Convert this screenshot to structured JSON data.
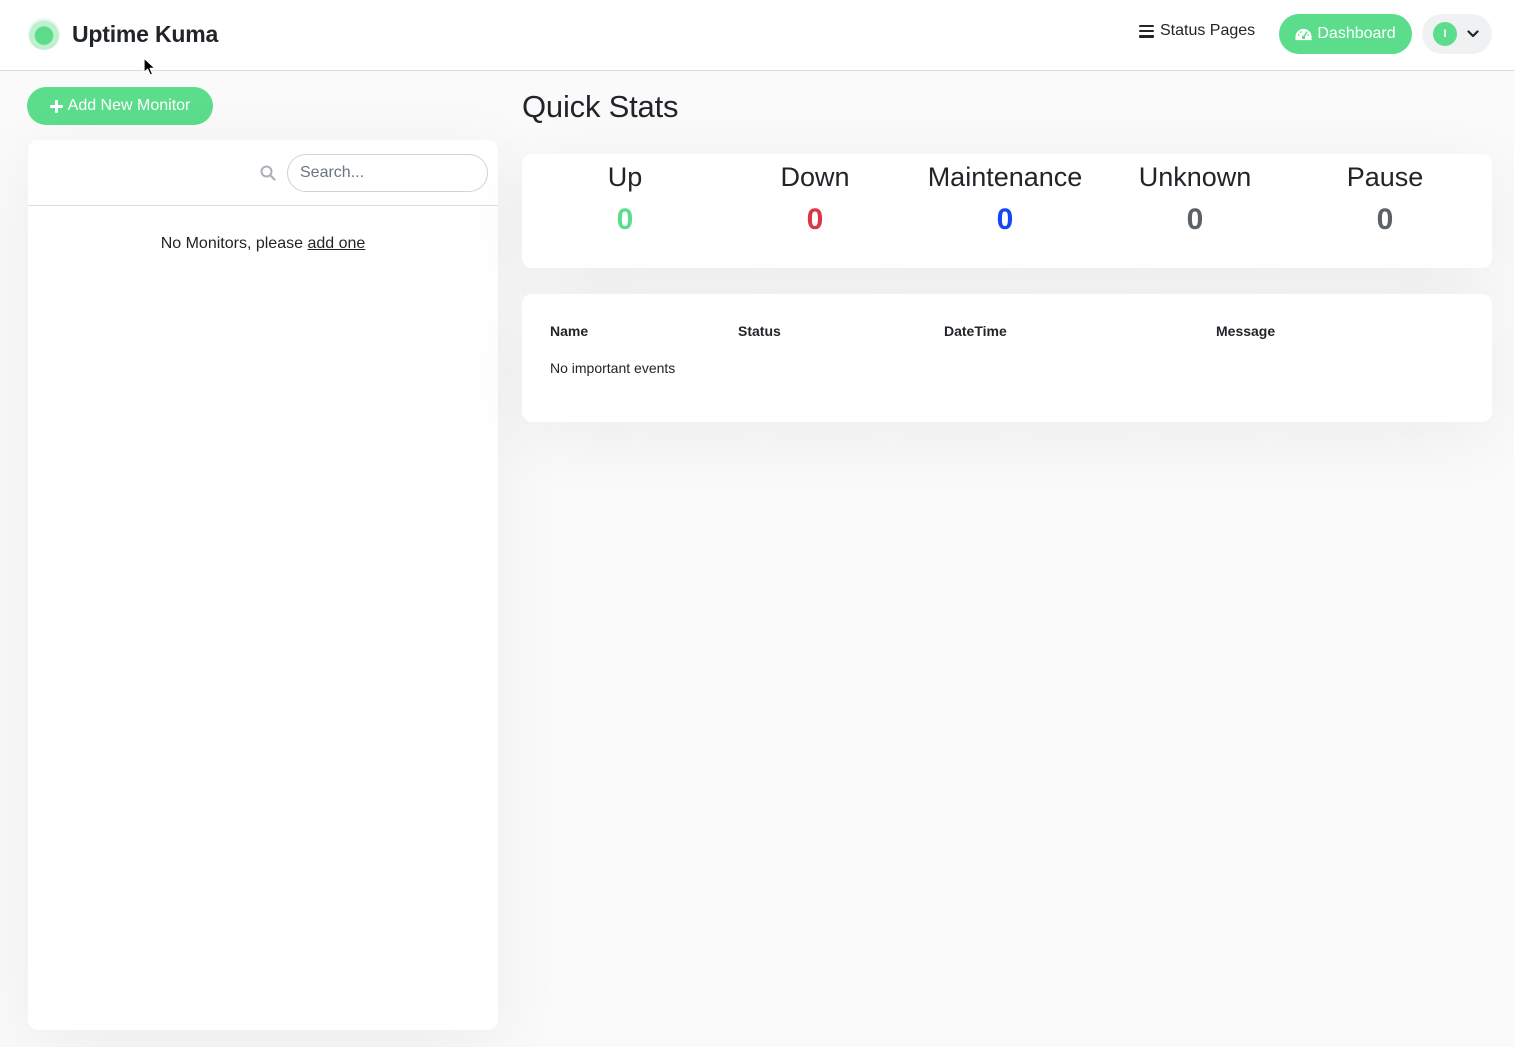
{
  "header": {
    "brand": "Uptime Kuma",
    "nav_status_pages": "Status Pages",
    "dashboard_label": "Dashboard",
    "avatar_initial": "I",
    "accent_color": "#5cdd8b"
  },
  "sidebar": {
    "add_button_label": "Add New Monitor",
    "search_placeholder": "Search...",
    "search_value": "",
    "empty_prefix": "No Monitors, please",
    "empty_link": "add one"
  },
  "main": {
    "title": "Quick Stats",
    "stats": [
      {
        "label": "Up",
        "value": "0",
        "color": "#5cdd8b"
      },
      {
        "label": "Down",
        "value": "0",
        "color": "#dc3545"
      },
      {
        "label": "Maintenance",
        "value": "0",
        "color": "#1747f5"
      },
      {
        "label": "Unknown",
        "value": "0",
        "color": "#5a6268"
      },
      {
        "label": "Pause",
        "value": "0",
        "color": "#5a6268"
      }
    ],
    "events_table": {
      "columns": [
        "Name",
        "Status",
        "DateTime",
        "Message"
      ],
      "empty_text": "No important events"
    }
  }
}
